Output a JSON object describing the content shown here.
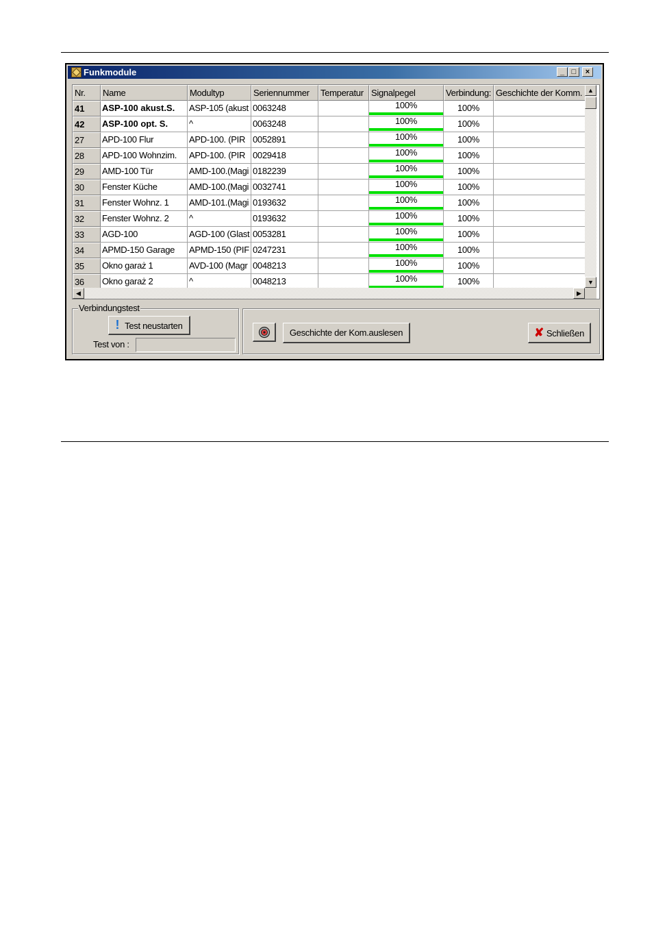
{
  "window": {
    "title": "Funkmodule",
    "caption_buttons": {
      "minimize": "_",
      "maximize": "□",
      "close": "×"
    }
  },
  "table": {
    "columns": [
      "Nr.",
      "Name",
      "Modultyp",
      "Seriennummer",
      "Temperatur",
      "Signalpegel",
      "Verbindung:",
      "Geschichte der Komm."
    ],
    "rows": [
      {
        "nr": "41",
        "name": "ASP-100 akust.S.",
        "type": "ASP-105 (akust",
        "serial": "0063248",
        "temp": "",
        "signal": "100%",
        "signal_level": 1.0,
        "conn": "100%",
        "history": "",
        "bold": true
      },
      {
        "nr": "42",
        "name": "ASP-100 opt. S.",
        "type": "^",
        "serial": "0063248",
        "temp": "",
        "signal": "100%",
        "signal_level": 1.0,
        "conn": "100%",
        "history": "",
        "bold": true
      },
      {
        "nr": "27",
        "name": "APD-100 Flur",
        "type": "APD-100. (PIR",
        "serial": "0052891",
        "temp": "",
        "signal": "100%",
        "signal_level": 1.0,
        "conn": "100%",
        "history": ""
      },
      {
        "nr": "28",
        "name": "APD-100 Wohnzim.",
        "type": "APD-100. (PIR",
        "serial": "0029418",
        "temp": "",
        "signal": "100%",
        "signal_level": 1.0,
        "conn": "100%",
        "history": ""
      },
      {
        "nr": "29",
        "name": "AMD-100 Tür",
        "type": "AMD-100.(Magi",
        "serial": "0182239",
        "temp": "",
        "signal": "100%",
        "signal_level": 1.0,
        "conn": "100%",
        "history": ""
      },
      {
        "nr": "30",
        "name": "Fenster Küche",
        "type": "AMD-100.(Magi",
        "serial": "0032741",
        "temp": "",
        "signal": "100%",
        "signal_level": 1.0,
        "conn": "100%",
        "history": ""
      },
      {
        "nr": "31",
        "name": "Fenster Wohnz. 1",
        "type": "AMD-101.(Magi",
        "serial": "0193632",
        "temp": "",
        "signal": "100%",
        "signal_level": 1.0,
        "conn": "100%",
        "history": ""
      },
      {
        "nr": "32",
        "name": "Fenster Wohnz. 2",
        "type": "^",
        "serial": "0193632",
        "temp": "",
        "signal": "100%",
        "signal_level": 1.0,
        "conn": "100%",
        "history": ""
      },
      {
        "nr": "33",
        "name": "AGD-100",
        "type": "AGD-100 (Glast",
        "serial": "0053281",
        "temp": "",
        "signal": "100%",
        "signal_level": 1.0,
        "conn": "100%",
        "history": ""
      },
      {
        "nr": "34",
        "name": "APMD-150 Garage",
        "type": "APMD-150 (PIF",
        "serial": "0247231",
        "temp": "",
        "signal": "100%",
        "signal_level": 1.0,
        "conn": "100%",
        "history": ""
      },
      {
        "nr": "35",
        "name": "Okno garaż 1",
        "type": "AVD-100 (Magr",
        "serial": "0048213",
        "temp": "",
        "signal": "100%",
        "signal_level": 1.0,
        "conn": "100%",
        "history": ""
      },
      {
        "nr": "36",
        "name": "Okno garaż 2",
        "type": "^",
        "serial": "0048213",
        "temp": "",
        "signal": "100%",
        "signal_level": 1.0,
        "conn": "100%",
        "history": ""
      }
    ]
  },
  "scrollbars": {
    "up": "▲",
    "down": "▼",
    "left": "◀",
    "right": "▶"
  },
  "connection_test": {
    "group_label": "Verbindungstest",
    "restart_icon": "!",
    "restart_label": "Test neustarten",
    "test_from_label": "Test von :",
    "test_from_value": ""
  },
  "actions": {
    "history_icon_name": "history-read-icon",
    "read_history_label": "Geschichte der Kom.auslesen",
    "close_icon": "✘",
    "close_label": "Schließen"
  },
  "colors": {
    "titlebar_start": "#0a246a",
    "titlebar_end": "#a6caf0",
    "signal_bar": "#00e000",
    "close_icon": "#cc0000",
    "restart_icon": "#1a6fd0"
  }
}
